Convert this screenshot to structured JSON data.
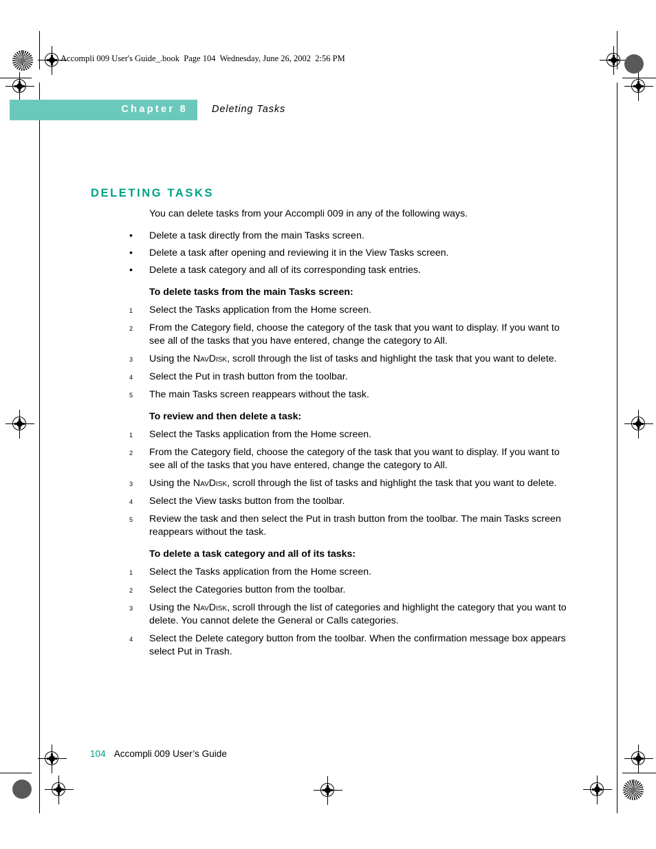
{
  "page": {
    "running_header": "Accompli 009 User's Guide_.book  Page 104  Wednesday, June 26, 2002  2:56 PM",
    "chapter_label": "Chapter 8",
    "chapter_title": "Deleting Tasks",
    "section_heading": "DELETING TASKS",
    "intro_paragraph": "You can delete tasks from your Accompli 009 in any of the following ways.",
    "bullet_marker": "•",
    "bullets": [
      "Delete a task directly from the main Tasks screen.",
      "Delete a task after opening and reviewing it in the View Tasks screen.",
      "Delete a task category and all of its corresponding task entries."
    ],
    "procedures": [
      {
        "heading": "To delete tasks from the main Tasks screen:",
        "steps": [
          {
            "num": "1",
            "text": "Select the Tasks application from the Home screen."
          },
          {
            "num": "2",
            "text": "From the Category field, choose the category of the task that you want to display. If you want to see all of the tasks that you have entered, change the category to All."
          },
          {
            "num": "3",
            "pre": "Using the ",
            "smallcaps": "NavDisk",
            "post": ", scroll through the list of tasks and highlight the task that you want to delete."
          },
          {
            "num": "4",
            "text": "Select the Put in trash button from the toolbar."
          },
          {
            "num": "5",
            "text": "The main Tasks screen reappears without the task."
          }
        ]
      },
      {
        "heading": "To review and then delete a task:",
        "steps": [
          {
            "num": "1",
            "text": "Select the Tasks application from the Home screen."
          },
          {
            "num": "2",
            "text": "From the Category field, choose the category of the task that you want to display. If you want to see all of the tasks that you have entered, change the category to All."
          },
          {
            "num": "3",
            "pre": "Using the ",
            "smallcaps": "NavDisk",
            "post": ", scroll through the list of tasks and highlight the task that you want to delete."
          },
          {
            "num": "4",
            "text": "Select the View tasks button from the toolbar."
          },
          {
            "num": "5",
            "text": "Review the task and then select the Put in trash button from the toolbar. The main Tasks screen reappears without the task."
          }
        ]
      },
      {
        "heading": "To delete a task category and all of its tasks:",
        "steps": [
          {
            "num": "1",
            "text": "Select the Tasks application from the Home screen."
          },
          {
            "num": "2",
            "text": "Select the Categories button from the toolbar."
          },
          {
            "num": "3",
            "pre": "Using the ",
            "smallcaps": "NavDisk",
            "post": ", scroll through the list of categories and highlight the category that you want to delete. You cannot delete the General or Calls categories."
          },
          {
            "num": "4",
            "text": "Select the Delete category button from the toolbar. When the confirmation message box appears select Put in Trash."
          }
        ]
      }
    ],
    "footer": {
      "page_number": "104",
      "guide_title": "Accompli 009 User’s Guide"
    },
    "colors": {
      "banner_teal": "#6ac9bc",
      "heading_teal": "#00a088",
      "text_black": "#000000"
    }
  }
}
